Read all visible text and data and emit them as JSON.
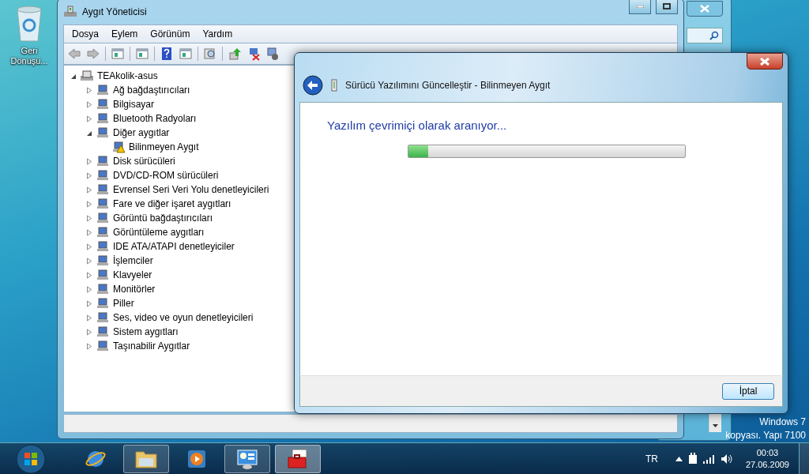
{
  "desktop": {
    "icons": [
      {
        "label": "Geri Dönüşü..."
      }
    ],
    "build_notice": [
      "Windows 7",
      "kopyası. Yapı 7100"
    ]
  },
  "device_manager": {
    "title": "Aygıt Yöneticisi",
    "menu": [
      "Dosya",
      "Eylem",
      "Görünüm",
      "Yardım"
    ],
    "tree": {
      "label": "TEAkolik-asus",
      "expanded": true,
      "children": [
        {
          "label": "Ağ bağdaştırıcıları",
          "expanded": false
        },
        {
          "label": "Bilgisayar",
          "expanded": false
        },
        {
          "label": "Bluetooth Radyoları",
          "expanded": false
        },
        {
          "label": "Diğer aygıtlar",
          "expanded": true,
          "children": [
            {
              "label": "Bilinmeyen Aygıt",
              "warning": true
            }
          ]
        },
        {
          "label": "Disk sürücüleri",
          "expanded": false
        },
        {
          "label": "DVD/CD-ROM sürücüleri",
          "expanded": false
        },
        {
          "label": "Evrensel Seri Veri Yolu denetleyicileri",
          "expanded": false
        },
        {
          "label": "Fare ve diğer işaret aygıtları",
          "expanded": false
        },
        {
          "label": "Görüntü bağdaştırıcıları",
          "expanded": false
        },
        {
          "label": "Görüntüleme aygıtları",
          "expanded": false
        },
        {
          "label": "IDE ATA/ATAPI denetleyiciler",
          "expanded": false
        },
        {
          "label": "İşlemciler",
          "expanded": false
        },
        {
          "label": "Klavyeler",
          "expanded": false
        },
        {
          "label": "Monitörler",
          "expanded": false
        },
        {
          "label": "Piller",
          "expanded": false
        },
        {
          "label": "Ses, video ve oyun denetleyicileri",
          "expanded": false
        },
        {
          "label": "Sistem aygıtları",
          "expanded": false
        },
        {
          "label": "Taşınabilir Aygıtlar",
          "expanded": false
        }
      ]
    }
  },
  "dialog": {
    "title": "Sürücü Yazılımını Güncelleştir - Bilinmeyen Aygıt",
    "heading": "Yazılım çevrimiçi olarak aranıyor...",
    "progress": {
      "level": 0.07
    },
    "buttons": [
      "İptal"
    ]
  },
  "taskbar": {
    "apps": [
      {
        "kind": "browser",
        "running": false,
        "selected": false
      },
      {
        "kind": "folder",
        "running": true,
        "selected": false
      },
      {
        "kind": "media",
        "running": false,
        "selected": false
      },
      {
        "kind": "panel",
        "running": true,
        "selected": false
      },
      {
        "kind": "toolbox",
        "running": true,
        "selected": true
      }
    ],
    "language": "TR",
    "time": "00:03",
    "date": "27.06.2009"
  }
}
